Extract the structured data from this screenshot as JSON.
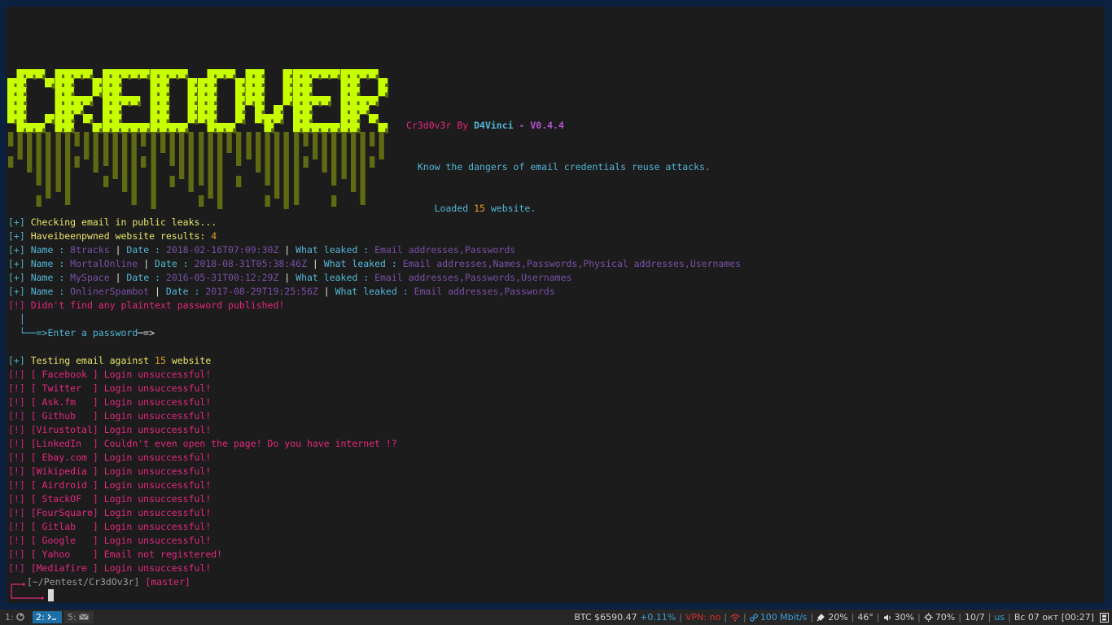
{
  "colors": {
    "terminal_bg": "#1c1c1c",
    "desktop_bg": "#0c2040",
    "logo_bright": "#c8ff00",
    "logo_dark": "#5f6a12",
    "bracket_plus": "#4ab0c8",
    "bracket_bang": "#c8228c",
    "yellow": "#e7e46a",
    "magenta": "#e3287e",
    "purple": "#7a4fa6",
    "cyan": "#52b6d6",
    "orange": "#e0a020",
    "white": "#e0e0e0",
    "violet": "#b553d1",
    "statusbar_bg": "#262626",
    "accent_blue": "#1d6fa8"
  },
  "banner": {
    "logo_text": "CREDOVER",
    "line1": {
      "name": "Cr3d0v3r",
      "by": " By ",
      "author": "D4Vinci",
      "dash": " - ",
      "version": "V0.4.4"
    },
    "line2": "Know the dangers of email credentials reuse attacks.",
    "line3": {
      "pre": "Loaded ",
      "count": "15",
      "post": " website."
    }
  },
  "terminal_lines": [
    {
      "segs": [
        {
          "t": "[+] ",
          "c": "bracket_plus"
        },
        {
          "t": "Checking email in public leaks...",
          "c": "yellow"
        }
      ]
    },
    {
      "segs": [
        {
          "t": "[+] ",
          "c": "bracket_plus"
        },
        {
          "t": "Haveibeenpwned website results: ",
          "c": "yellow"
        },
        {
          "t": "4",
          "c": "orange"
        }
      ]
    },
    {
      "segs": [
        {
          "t": "[+] ",
          "c": "bracket_plus"
        },
        {
          "t": "Name : ",
          "c": "cyan"
        },
        {
          "t": "8tracks",
          "c": "purple"
        },
        {
          "t": " | ",
          "c": "white"
        },
        {
          "t": "Date : ",
          "c": "cyan"
        },
        {
          "t": "2018-02-16T07:09:30Z",
          "c": "purple"
        },
        {
          "t": " | ",
          "c": "white"
        },
        {
          "t": "What leaked : ",
          "c": "cyan"
        },
        {
          "t": "Email addresses,Passwords",
          "c": "purple"
        }
      ]
    },
    {
      "segs": [
        {
          "t": "[+] ",
          "c": "bracket_plus"
        },
        {
          "t": "Name : ",
          "c": "cyan"
        },
        {
          "t": "MortalOnline",
          "c": "purple"
        },
        {
          "t": " | ",
          "c": "white"
        },
        {
          "t": "Date : ",
          "c": "cyan"
        },
        {
          "t": "2018-08-31T05:38:46Z",
          "c": "purple"
        },
        {
          "t": " | ",
          "c": "white"
        },
        {
          "t": "What leaked : ",
          "c": "cyan"
        },
        {
          "t": "Email addresses,Names,Passwords,Physical addresses,Usernames",
          "c": "purple"
        }
      ]
    },
    {
      "segs": [
        {
          "t": "[+] ",
          "c": "bracket_plus"
        },
        {
          "t": "Name : ",
          "c": "cyan"
        },
        {
          "t": "MySpace",
          "c": "purple"
        },
        {
          "t": " | ",
          "c": "white"
        },
        {
          "t": "Date : ",
          "c": "cyan"
        },
        {
          "t": "2016-05-31T00:12:29Z",
          "c": "purple"
        },
        {
          "t": " | ",
          "c": "white"
        },
        {
          "t": "What leaked : ",
          "c": "cyan"
        },
        {
          "t": "Email addresses,Passwords,Usernames",
          "c": "purple"
        }
      ]
    },
    {
      "segs": [
        {
          "t": "[+] ",
          "c": "bracket_plus"
        },
        {
          "t": "Name : ",
          "c": "cyan"
        },
        {
          "t": "OnlinerSpambot",
          "c": "purple"
        },
        {
          "t": " | ",
          "c": "white"
        },
        {
          "t": "Date : ",
          "c": "cyan"
        },
        {
          "t": "2017-08-29T19:25:56Z",
          "c": "purple"
        },
        {
          "t": " | ",
          "c": "white"
        },
        {
          "t": "What leaked : ",
          "c": "cyan"
        },
        {
          "t": "Email addresses,Passwords",
          "c": "purple"
        }
      ]
    },
    {
      "segs": [
        {
          "t": "[!] ",
          "c": "bracket_bang"
        },
        {
          "t": "Didn't find any plaintext password published!",
          "c": "magenta"
        }
      ]
    },
    {
      "segs": [
        {
          "t": "  │",
          "c": "cyan"
        }
      ]
    },
    {
      "segs": [
        {
          "t": "  └──",
          "c": "cyan"
        },
        {
          "t": "=>Enter a password",
          "c": "cyan"
        },
        {
          "t": "─=>",
          "c": "white"
        }
      ]
    },
    {
      "segs": []
    },
    {
      "segs": [
        {
          "t": "[+] ",
          "c": "bracket_plus"
        },
        {
          "t": "Testing email against ",
          "c": "yellow"
        },
        {
          "t": "15",
          "c": "orange"
        },
        {
          "t": " website",
          "c": "yellow"
        }
      ]
    },
    {
      "segs": [
        {
          "t": "[!] ",
          "c": "bracket_bang"
        },
        {
          "t": "[ Facebook ] Login unsuccessful!",
          "c": "magenta"
        }
      ]
    },
    {
      "segs": [
        {
          "t": "[!] ",
          "c": "bracket_bang"
        },
        {
          "t": "[ Twitter  ] Login unsuccessful!",
          "c": "magenta"
        }
      ]
    },
    {
      "segs": [
        {
          "t": "[!] ",
          "c": "bracket_bang"
        },
        {
          "t": "[ Ask.fm   ] Login unsuccessful!",
          "c": "magenta"
        }
      ]
    },
    {
      "segs": [
        {
          "t": "[!] ",
          "c": "bracket_bang"
        },
        {
          "t": "[ Github   ] Login unsuccessful!",
          "c": "magenta"
        }
      ]
    },
    {
      "segs": [
        {
          "t": "[!] ",
          "c": "bracket_bang"
        },
        {
          "t": "[Virustotal] Login unsuccessful!",
          "c": "magenta"
        }
      ]
    },
    {
      "segs": [
        {
          "t": "[!] ",
          "c": "bracket_bang"
        },
        {
          "t": "[LinkedIn  ] Couldn't even open the page! Do you have internet !?",
          "c": "magenta"
        }
      ]
    },
    {
      "segs": [
        {
          "t": "[!] ",
          "c": "bracket_bang"
        },
        {
          "t": "[ Ebay.com ] Login unsuccessful!",
          "c": "magenta"
        }
      ]
    },
    {
      "segs": [
        {
          "t": "[!] ",
          "c": "bracket_bang"
        },
        {
          "t": "[Wikipedia ] Login unsuccessful!",
          "c": "magenta"
        }
      ]
    },
    {
      "segs": [
        {
          "t": "[!] ",
          "c": "bracket_bang"
        },
        {
          "t": "[ Airdroid ] Login unsuccessful!",
          "c": "magenta"
        }
      ]
    },
    {
      "segs": [
        {
          "t": "[!] ",
          "c": "bracket_bang"
        },
        {
          "t": "[ StackOF  ] Login unsuccessful!",
          "c": "magenta"
        }
      ]
    },
    {
      "segs": [
        {
          "t": "[!] ",
          "c": "bracket_bang"
        },
        {
          "t": "[FourSquare] Login unsuccessful!",
          "c": "magenta"
        }
      ]
    },
    {
      "segs": [
        {
          "t": "[!] ",
          "c": "bracket_bang"
        },
        {
          "t": "[ Gitlab   ] Login unsuccessful!",
          "c": "magenta"
        }
      ]
    },
    {
      "segs": [
        {
          "t": "[!] ",
          "c": "bracket_bang"
        },
        {
          "t": "[ Google   ] Login unsuccessful!",
          "c": "magenta"
        }
      ]
    },
    {
      "segs": [
        {
          "t": "[!] ",
          "c": "bracket_bang"
        },
        {
          "t": "[ Yahoo    ] Email not registered!",
          "c": "magenta"
        }
      ]
    },
    {
      "segs": [
        {
          "t": "[!] ",
          "c": "bracket_bang"
        },
        {
          "t": "[Mediafire ] Login unsuccessful!",
          "c": "magenta"
        }
      ]
    }
  ],
  "prompt": {
    "path": "[~/Pentest/Cr3dOv3r]",
    "branch": "[master]"
  },
  "statusbar": {
    "workspaces": [
      {
        "label": "1:",
        "icon": "firefox-icon"
      },
      {
        "label": "2:",
        "icon": "terminal-icon"
      },
      {
        "label": "5:",
        "icon": "mail-icon"
      }
    ],
    "btc": "BTC $6590.47",
    "btc_change": "+0.11%",
    "vpn": "VPN: no",
    "net_speed": "100 Mbit/s",
    "power": "20%",
    "temp": "46°",
    "volume": "30%",
    "brightness": "70%",
    "updates": "10/7",
    "layout": "us",
    "date": "Вс 07 окт",
    "time": "[00:27]"
  }
}
